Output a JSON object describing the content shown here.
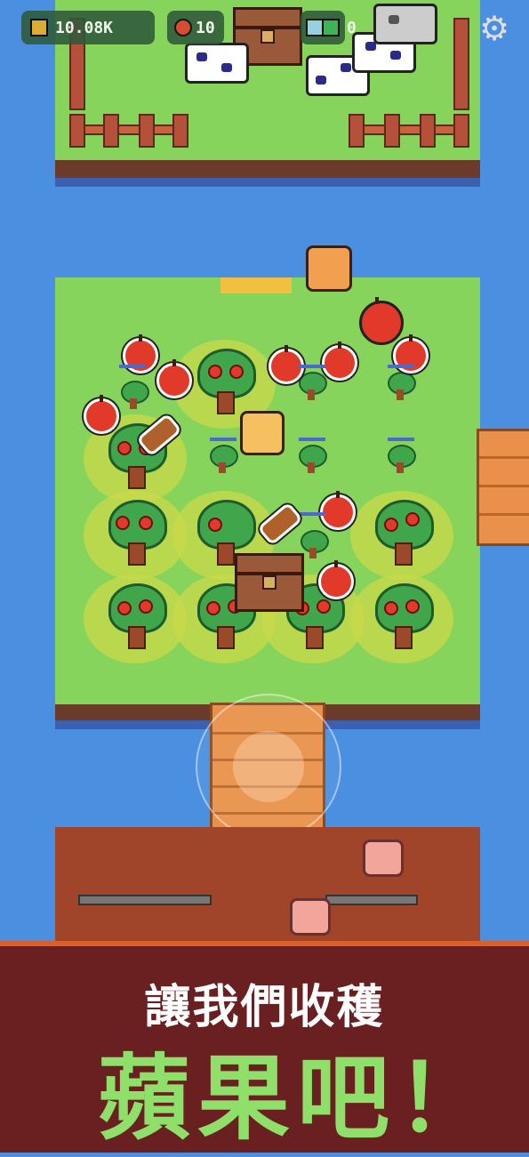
{
  "hud": {
    "coins": "10.08K",
    "apples": "10",
    "potions": "0",
    "gems": "0",
    "settings_icon": "gear-icon"
  },
  "banner": {
    "line1": "讓我們收穫",
    "line2": "蘋果吧！"
  },
  "colors": {
    "water": "#4a8fe0",
    "grass": "#86d45c",
    "banner_bg": "#6a2020",
    "banner_accent": "#d9602a",
    "headline_green": "#8ee06a",
    "apple_red": "#e23a2a"
  }
}
